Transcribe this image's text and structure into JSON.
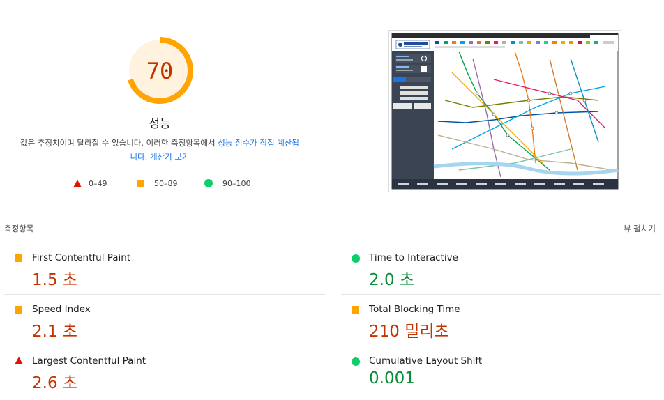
{
  "summary": {
    "score": "70",
    "score_label": "성능",
    "score_fraction": 0.7,
    "description_plain": "값은 추정치이며 달라질 수 있습니다. 이러한 측정항목에서 ",
    "description_link": "성능 점수가 직접 계산됩니다.",
    "calculator_link": "계산기 보기",
    "colors": {
      "score_text": "#c33300",
      "gauge_arc": "#ffa400",
      "gauge_fill": "#fff3e0"
    }
  },
  "legend": [
    {
      "icon": "triangle",
      "color": "#eb0f00",
      "label": "0–49"
    },
    {
      "icon": "square",
      "color": "#ffa400",
      "label": "50–89"
    },
    {
      "icon": "circle",
      "color": "#0cce6b",
      "label": "90–100"
    }
  ],
  "metrics_header": {
    "label": "측정항목",
    "toggle_label": "뷰 펼치기"
  },
  "metrics": [
    {
      "name": "First Contentful Paint",
      "value": "1.5 초",
      "rating": "average",
      "icon": "square"
    },
    {
      "name": "Time to Interactive",
      "value": "2.0 초",
      "rating": "pass",
      "icon": "circle"
    },
    {
      "name": "Speed Index",
      "value": "2.1 초",
      "rating": "average",
      "icon": "square"
    },
    {
      "name": "Total Blocking Time",
      "value": "210 밀리초",
      "rating": "average",
      "icon": "square"
    },
    {
      "name": "Largest Contentful Paint",
      "value": "2.6 초",
      "rating": "fail",
      "icon": "triangle"
    },
    {
      "name": "Cumulative Layout Shift",
      "value": "0.001",
      "rating": "pass",
      "icon": "circle"
    }
  ],
  "screenshot": {
    "brand": "서울교통공사",
    "sidebar_items": [
      "역명검색",
      "최단경로"
    ]
  }
}
